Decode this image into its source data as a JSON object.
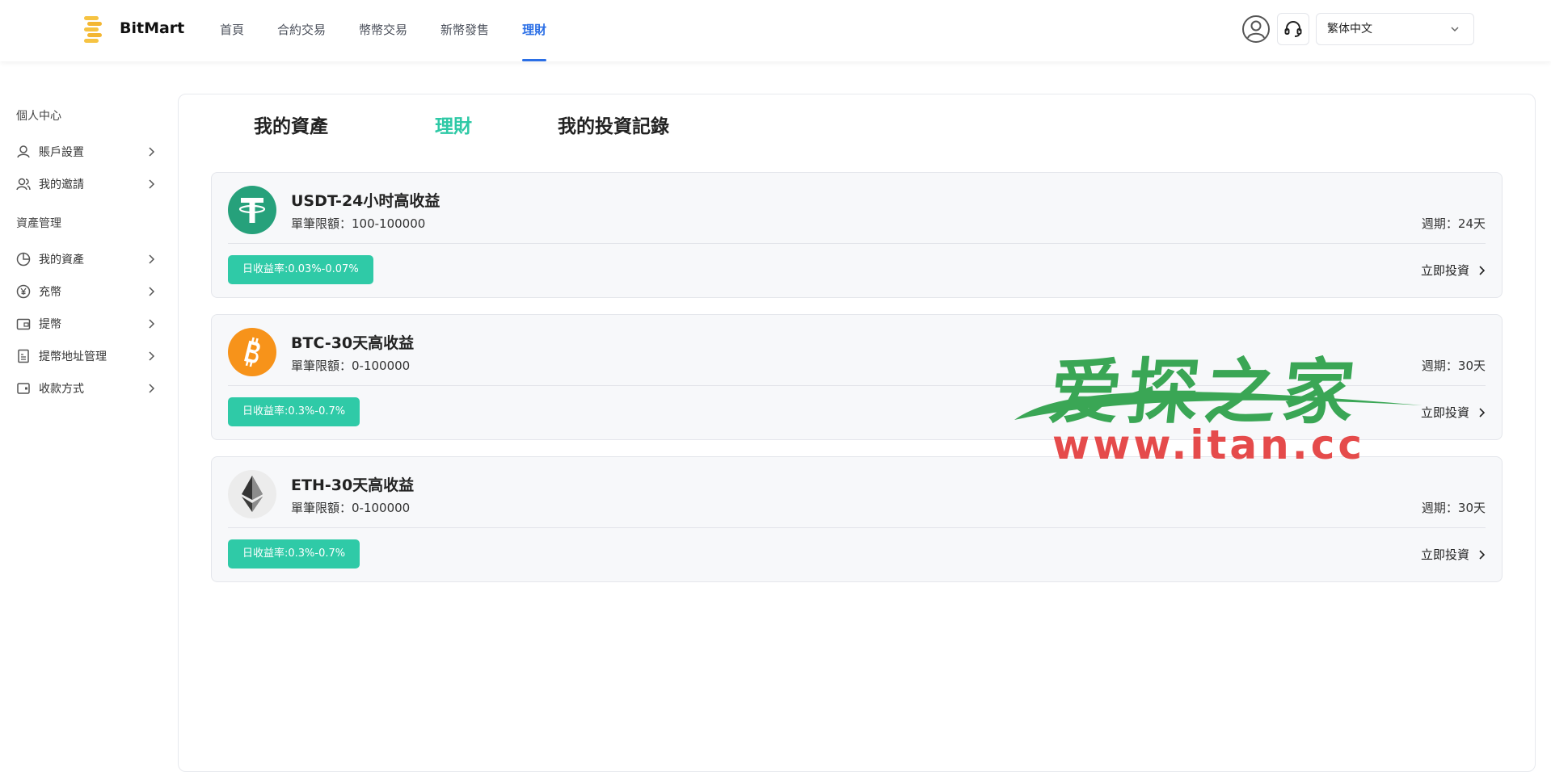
{
  "header": {
    "brand": "BitMart",
    "nav": [
      {
        "label": "首頁",
        "active": false
      },
      {
        "label": "合約交易",
        "active": false
      },
      {
        "label": "幣幣交易",
        "active": false
      },
      {
        "label": "新幣發售",
        "active": false
      },
      {
        "label": "理財",
        "active": true
      }
    ],
    "language": "繁体中文",
    "icons": [
      "user-avatar-icon",
      "headset-icon",
      "chevron-down-icon"
    ]
  },
  "sidebar": {
    "section1": "個人中心",
    "section1_items": [
      {
        "label": "賬戶設置",
        "icon": "user-icon"
      },
      {
        "label": "我的邀請",
        "icon": "users-icon"
      }
    ],
    "section2": "資產管理",
    "section2_items": [
      {
        "label": "我的資產",
        "icon": "pie-chart-icon"
      },
      {
        "label": "充幣",
        "icon": "yen-coin-icon"
      },
      {
        "label": "提幣",
        "icon": "wallet-icon"
      },
      {
        "label": "提幣地址管理",
        "icon": "document-icon"
      },
      {
        "label": "收款方式",
        "icon": "wallet-card-icon"
      }
    ]
  },
  "tabs": [
    {
      "label": "我的資產",
      "active": false
    },
    {
      "label": "理財",
      "active": true
    },
    {
      "label": "我的投資記錄",
      "active": false
    }
  ],
  "products": [
    {
      "coin": "USDT",
      "title": "USDT-24小时高收益",
      "limit": "單筆限額：100-100000",
      "period": "週期：24天",
      "rate": "日收益率:0.03%-0.07%",
      "action": "立即投資",
      "color": "#26a17b"
    },
    {
      "coin": "BTC",
      "title": "BTC-30天高收益",
      "limit": "單筆限額：0-100000",
      "period": "週期：30天",
      "rate": "日收益率:0.3%-0.7%",
      "action": "立即投資",
      "color": "#f7931a"
    },
    {
      "coin": "ETH",
      "title": "ETH-30天高收益",
      "limit": "單筆限額：0-100000",
      "period": "週期：30天",
      "rate": "日收益率:0.3%-0.7%",
      "action": "立即投資",
      "color": "#ececec"
    }
  ],
  "watermark": {
    "cn": "爱探之家",
    "url": "www.itan.cc"
  },
  "colors": {
    "accent_blue": "#2b6fe6",
    "accent_teal": "#2fcaa7"
  }
}
